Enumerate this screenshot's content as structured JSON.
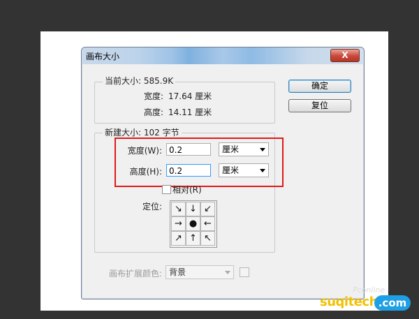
{
  "dialog": {
    "title": "画布大小",
    "close_label": "X",
    "ok_label": "确定",
    "reset_label": "复位"
  },
  "current_size": {
    "legend": "当前大小: 585.9K",
    "width_label": "宽度:",
    "width_value": "17.64 厘米",
    "height_label": "高度:",
    "height_value": "14.11 厘米"
  },
  "new_size": {
    "legend": "新建大小: 102 字节",
    "width_label": "宽度(W):",
    "width_value": "0.2",
    "width_unit": "厘米",
    "height_label": "高度(H):",
    "height_value": "0.2",
    "height_unit": "厘米",
    "relative_label": "相对(R)",
    "anchor_label": "定位:",
    "anchor_cells": [
      "↘",
      "↓",
      "↙",
      "→",
      "●",
      "←",
      "↗",
      "↑",
      "↖"
    ]
  },
  "extension_color": {
    "label": "画布扩展颜色:",
    "value": "背景"
  },
  "watermark": {
    "line1": "Pconline",
    "brand": "suqitech",
    "suffix": ".com"
  },
  "colors": {
    "highlight_box": "#e01818",
    "background": "#333333",
    "dialog": "#f0f0f0"
  }
}
